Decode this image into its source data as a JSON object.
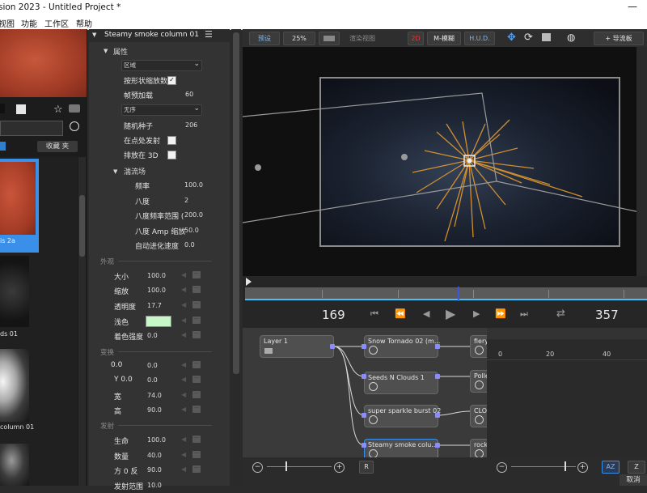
{
  "window": {
    "title": "sion 2023 - Untitled Project *",
    "minimize": "—"
  },
  "menu": [
    "视图",
    "功能",
    "工作区",
    "帮助"
  ],
  "library": {
    "bookmark_button": "收藏 夹",
    "items": [
      {
        "label": "is 2a"
      },
      {
        "label": "ds 01"
      },
      {
        "label": "column 01"
      }
    ]
  },
  "props": {
    "title": "Steamy smoke column 01",
    "group_attributes": "属性",
    "zone_select": "区域",
    "rows1": [
      {
        "label": "按形状缩放数",
        "value": "✓"
      },
      {
        "label": "帧预加载",
        "value": "60"
      }
    ],
    "none_select": "无序",
    "rows2": [
      {
        "label": "随机种子",
        "value": "206"
      },
      {
        "label": "在点处发射",
        "value": ""
      },
      {
        "label": "排放在 3D",
        "value": ""
      }
    ],
    "turbulence": "湍流场",
    "turb_rows": [
      {
        "label": "频率",
        "value": "100.0"
      },
      {
        "label": "八度",
        "value": "2"
      },
      {
        "label": "八度频率范围 (",
        "value": "200.0"
      },
      {
        "label": "八度 Amp 缩放",
        "value": "50.0"
      },
      {
        "label": "自动进化速度",
        "value": "0.0"
      }
    ],
    "section_appearance": "外观",
    "appearance_rows": [
      {
        "label": "大小",
        "value": "100.0"
      },
      {
        "label": "缩放",
        "value": "100.0"
      },
      {
        "label": "透明度",
        "value": "17.7"
      },
      {
        "label": "浅色",
        "value": ""
      },
      {
        "label": "着色强度",
        "value": "0.0"
      }
    ],
    "section_transform": "变换",
    "transform_rows": [
      {
        "label": "0.0",
        "value": "0.0"
      },
      {
        "label": "Y 0.0",
        "value": "0.0"
      },
      {
        "label": "宽",
        "value": "74.0"
      },
      {
        "label": "高",
        "value": "90.0"
      }
    ],
    "section_emit": "发射",
    "emit_rows": [
      {
        "label": "生命",
        "value": "100.0"
      },
      {
        "label": "数量",
        "value": "40.0"
      },
      {
        "label": "方 0 反",
        "value": "90.0"
      },
      {
        "label": "发射范围",
        "value": "10.0"
      }
    ]
  },
  "toolbar": {
    "preview": "预设",
    "zoom": "25%",
    "render_view": "渲染视图",
    "mode_2d": "2D",
    "mblur": "M-模糊",
    "hud": "H.U.D.",
    "guides": "+ 导流板"
  },
  "transport": {
    "current_frame": "169",
    "end_frame": "357"
  },
  "nodes": [
    {
      "label": "Layer 1"
    },
    {
      "label": "Snow Tornado 02 (m..."
    },
    {
      "label": "Seeds N Clouds 1"
    },
    {
      "label": "super sparkle burst 02"
    },
    {
      "label": "Steamy smoke colu..."
    },
    {
      "label": "fiery"
    },
    {
      "label": "Polle"
    },
    {
      "label": "CLO"
    },
    {
      "label": "rock"
    }
  ],
  "graph": {
    "ticks": [
      "0",
      "20",
      "40"
    ]
  },
  "bottom": {
    "r_button": "R",
    "az_button": "AZ",
    "z_button": "Z",
    "cancel": "取消"
  },
  "colors": {
    "accent": "#3a8fe8",
    "tint_swatch": "#c6f7c6",
    "node_port": "#8c8cff"
  }
}
